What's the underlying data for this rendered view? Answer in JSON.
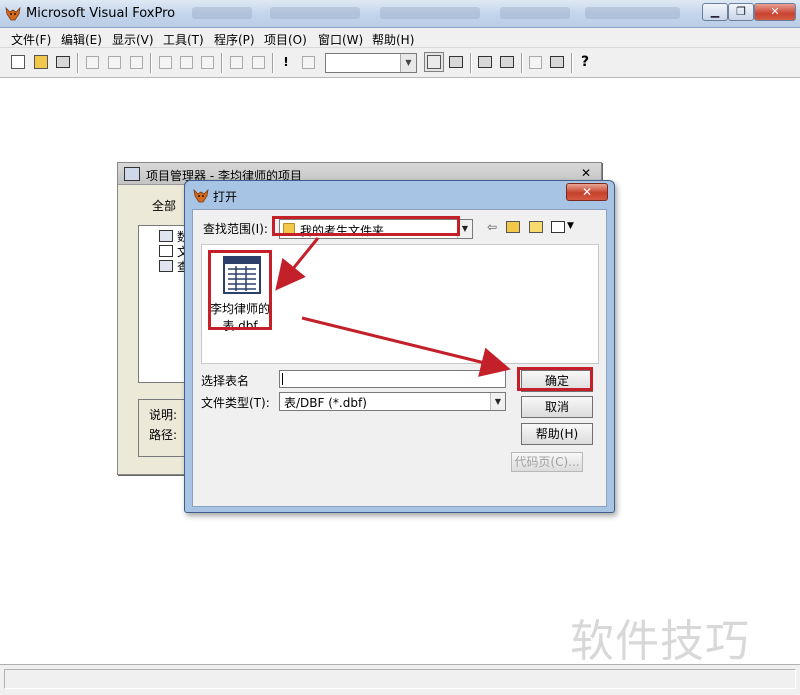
{
  "window": {
    "title": "Microsoft Visual FoxPro"
  },
  "menu": [
    "文件(F)",
    "编辑(E)",
    "显示(V)",
    "工具(T)",
    "程序(P)",
    "项目(O)",
    "窗口(W)",
    "帮助(H)"
  ],
  "toolbar": {
    "help_glyph": "?",
    "run_glyph": "!"
  },
  "project_manager": {
    "title": "项目管理器 - 李均律师的项目",
    "tab_all": "全部",
    "tree_items": [
      "数",
      "文",
      "查"
    ],
    "desc_label": "说明:",
    "path_label": "路径:"
  },
  "open_dialog": {
    "title": "打开",
    "look_in_label": "查找范围(I):",
    "look_in_value": "我的考生文件夹",
    "file_name_line1": "李均律师的",
    "file_name_line2": "表.dbf",
    "select_table_label": "选择表名",
    "select_table_value": "",
    "file_type_label": "文件类型(T):",
    "file_type_value": "表/DBF (*.dbf)",
    "ok_button": "确定",
    "cancel_button": "取消",
    "help_button": "帮助(H)",
    "codepage_button": "代码页(C)..."
  },
  "watermark": "软件技巧",
  "colors": {
    "annotation_red": "#c4202a"
  }
}
